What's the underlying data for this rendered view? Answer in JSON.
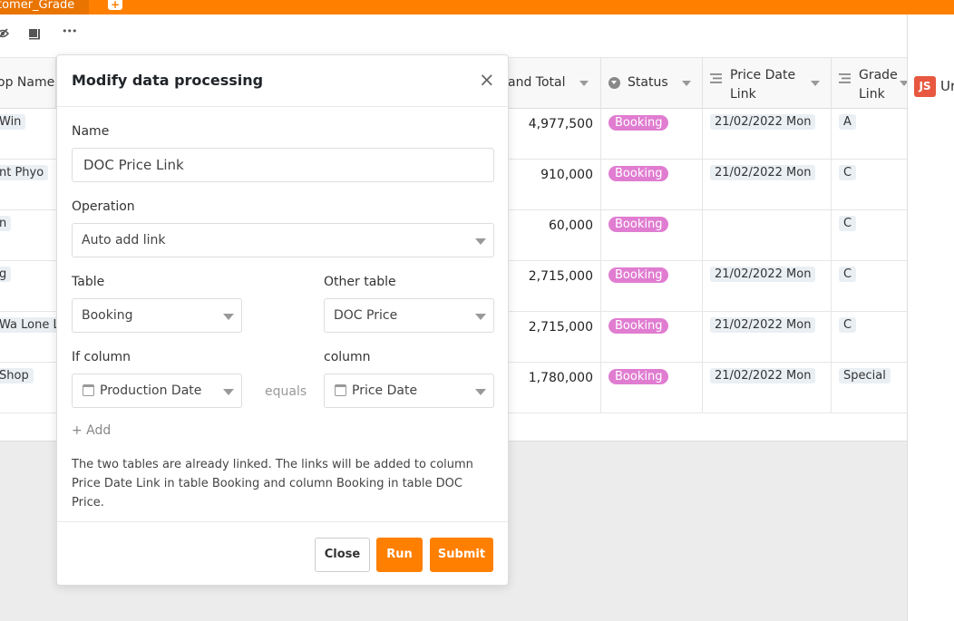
{
  "app": {
    "tab_title": "tomer_Grade",
    "add_tab_label": "+"
  },
  "toolbar": {
    "hide_icon": "eye-off-icon",
    "layout_icon": "layout-icon",
    "more_label": "•••"
  },
  "table": {
    "headers": {
      "shop_name": "op Name",
      "grand_total": "and Total",
      "status": "Status",
      "price_date_link": "Price Date Link",
      "grade_link": "Grade Link"
    },
    "rows": [
      {
        "shop": "Win",
        "total": "4,977,500",
        "status": "Booking",
        "date": "21/02/2022 Mon",
        "grade": "A"
      },
      {
        "shop": "nt Phyo",
        "total": "910,000",
        "status": "Booking",
        "date": "21/02/2022 Mon",
        "grade": "C"
      },
      {
        "shop": "n",
        "total": "60,000",
        "status": "Booking",
        "date": "",
        "grade": "C"
      },
      {
        "shop": "g",
        "total": "2,715,000",
        "status": "Booking",
        "date": "21/02/2022 Mon",
        "grade": "C"
      },
      {
        "shop": "Wa Lone L",
        "total": "2,715,000",
        "status": "Booking",
        "date": "21/02/2022 Mon",
        "grade": "C"
      },
      {
        "shop": "Shop",
        "total": "1,780,000",
        "status": "Booking",
        "date": "21/02/2022 Mon",
        "grade": "Special"
      }
    ]
  },
  "side_panel": {
    "badge": "JS",
    "label": "Ur"
  },
  "dialog": {
    "title": "Modify data processing",
    "close_glyph": "×",
    "name_label": "Name",
    "name_value": "DOC Price Link",
    "operation_label": "Operation",
    "operation_value": "Auto add link",
    "table_label": "Table",
    "table_value": "Booking",
    "other_table_label": "Other table",
    "other_table_value": "DOC Price",
    "if_column_label": "If column",
    "if_column_value": "Production Date",
    "equals_label": "equals",
    "column_label": "column",
    "column_value": "Price Date",
    "add_label": "+ Add",
    "note": "The two tables are already linked. The links will be added to column Price Date Link in table Booking and column Booking in table DOC Price.",
    "buttons": {
      "close": "Close",
      "run": "Run",
      "submit": "Submit"
    }
  },
  "colors": {
    "accent": "#ff8000",
    "status_badge": "#e07dd1",
    "js_badge": "#e8573f"
  }
}
